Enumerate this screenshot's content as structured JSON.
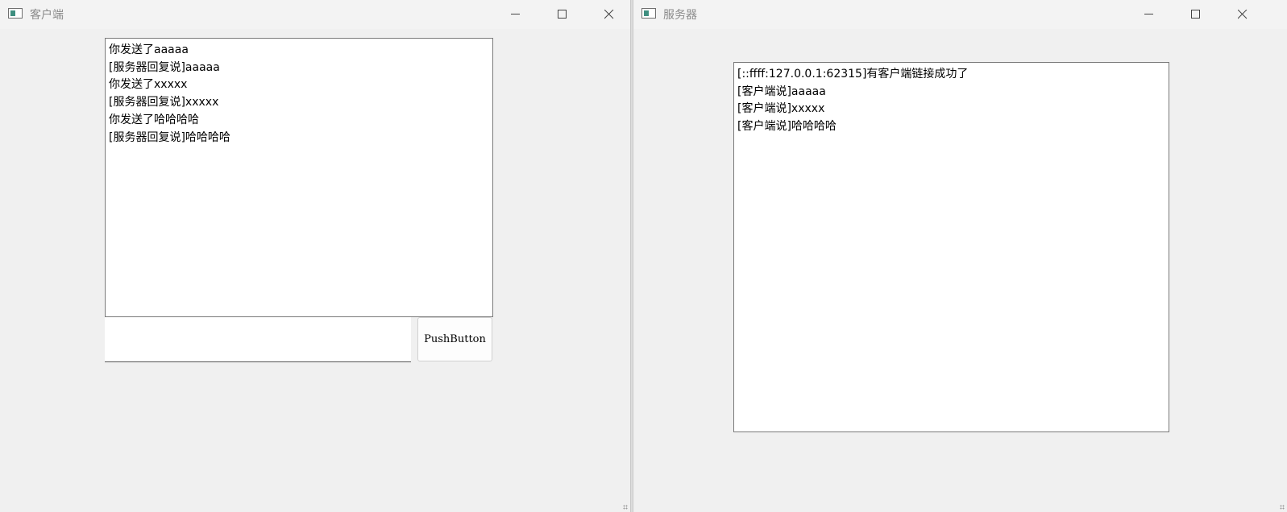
{
  "client": {
    "title": "客户端",
    "log_lines": [
      "你发送了aaaaa",
      "[服务器回复说]aaaaa",
      "你发送了xxxxx",
      "[服务器回复说]xxxxx",
      "你发送了哈哈哈哈",
      "[服务器回复说]哈哈哈哈"
    ],
    "input_value": "",
    "button_label": "PushButton"
  },
  "server": {
    "title": "服务器",
    "log_lines": [
      "[::ffff:127.0.0.1:62315]有客户端链接成功了",
      "[客户端说]aaaaa",
      "[客户端说]xxxxx",
      "[客户端说]哈哈哈哈"
    ]
  },
  "icons": {
    "app": "app-window-icon",
    "minimize": "minimize-icon",
    "maximize": "maximize-icon",
    "close": "close-icon",
    "resize": "resize-grip-icon"
  }
}
